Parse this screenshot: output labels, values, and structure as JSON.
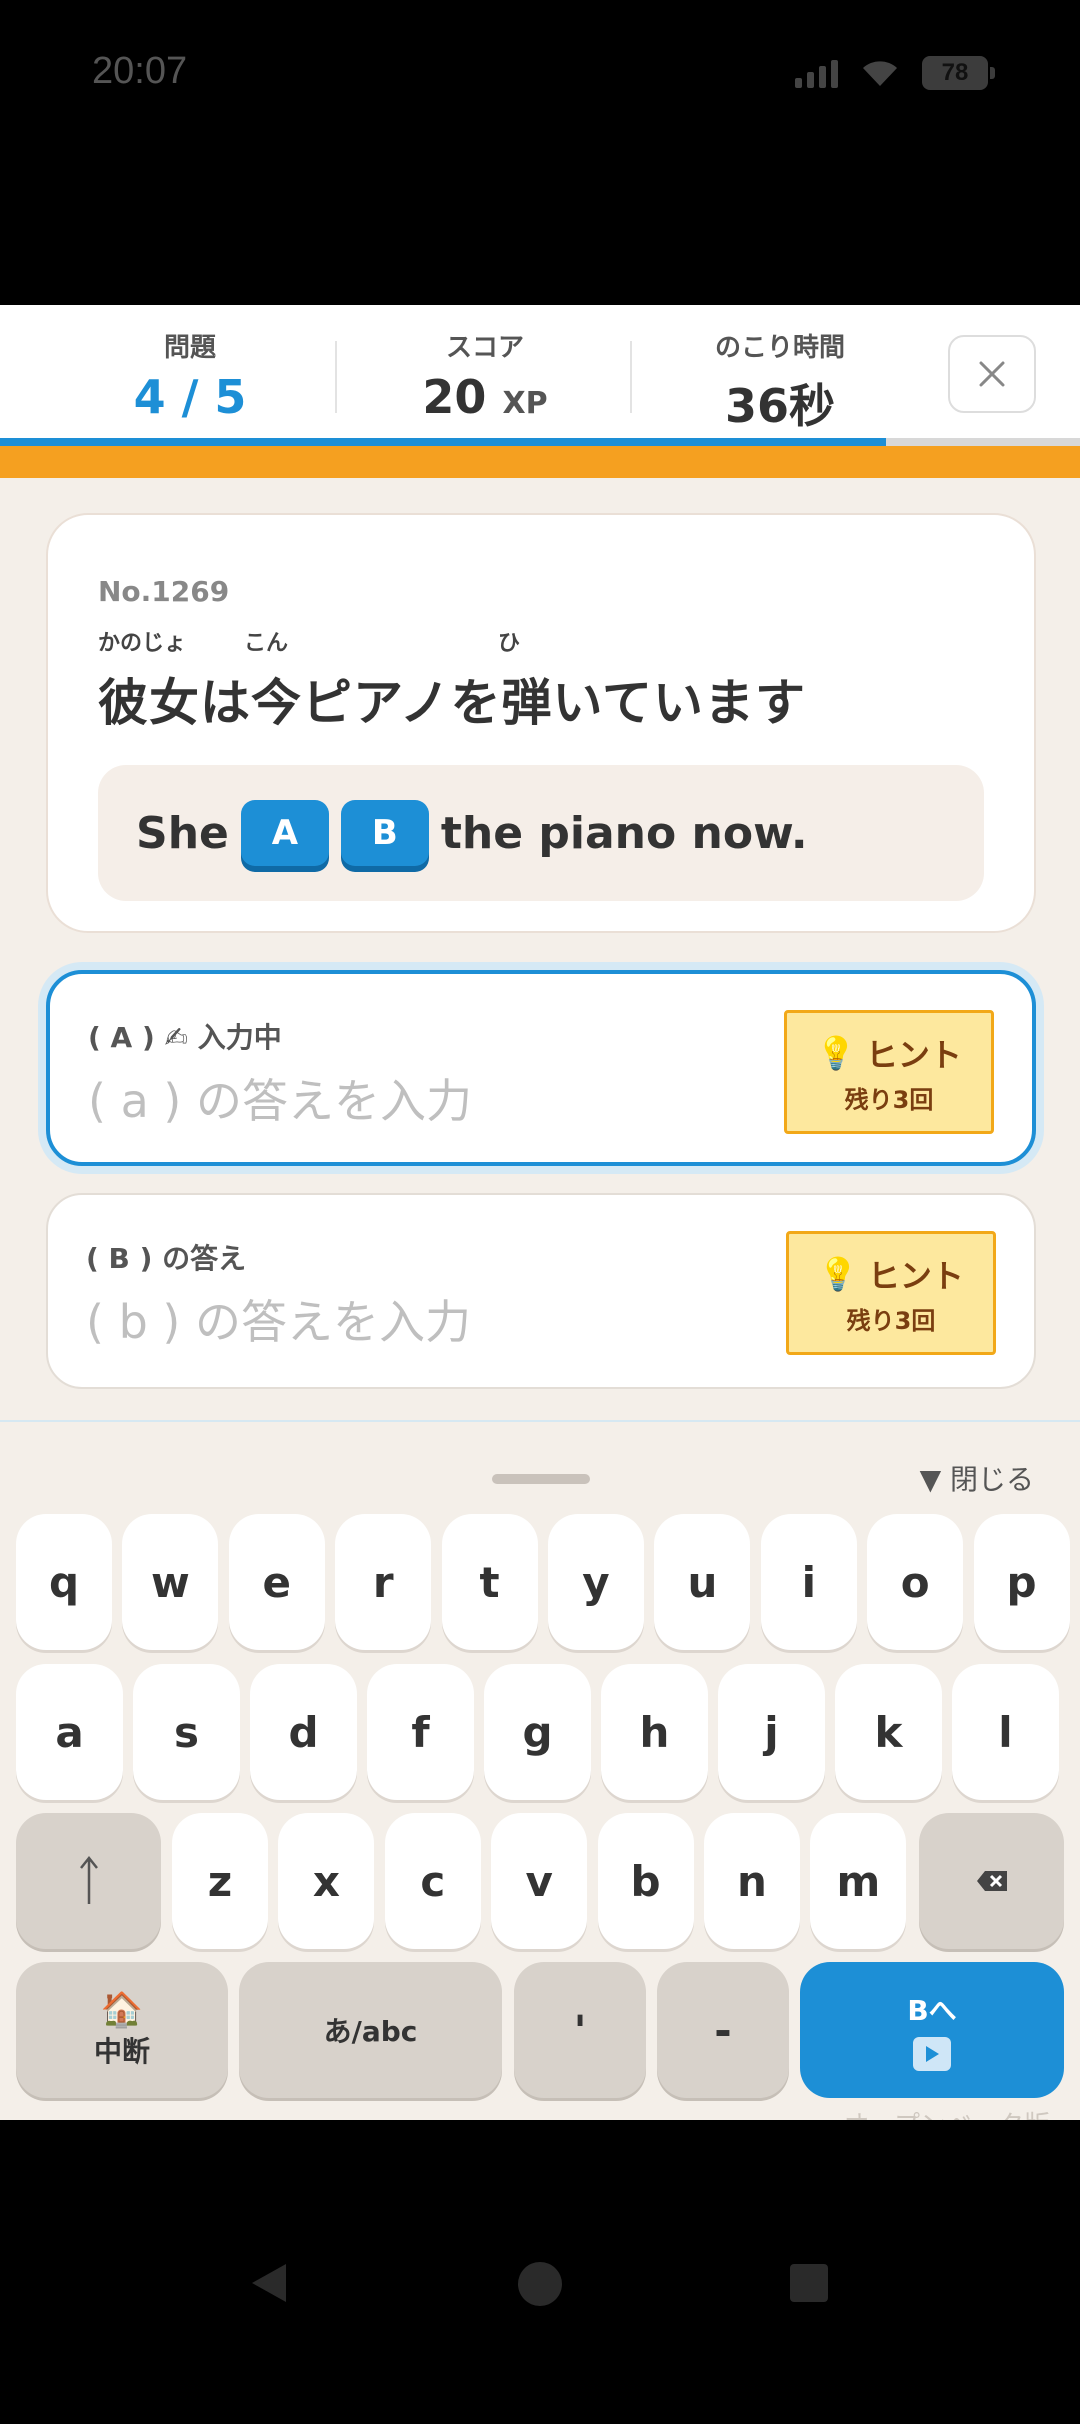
{
  "status_bar": {
    "time": "20:07",
    "battery": "78"
  },
  "header": {
    "question_label": "問題",
    "question_value": "4 / 5",
    "score_label": "スコア",
    "score_value": "20",
    "score_unit": "XP",
    "time_label": "のこり時間",
    "time_value": "36秒",
    "progress_fraction": 0.82
  },
  "question": {
    "number": "No.1269",
    "ruby": [
      "かのじょ",
      "こん",
      "ひ"
    ],
    "japanese": "彼女は今ピアノを弾いています",
    "english_before": "She",
    "blank_a": "A",
    "blank_b": "B",
    "english_after": "the piano now."
  },
  "answers": [
    {
      "label": "( A ) ✍ 入力中",
      "placeholder": "( a ) の答えを入力",
      "hint_label": "ヒント",
      "hint_remaining": "残り3回"
    },
    {
      "label": "( B ) の答え",
      "placeholder": "( b ) の答えを入力",
      "hint_label": "ヒント",
      "hint_remaining": "残り3回"
    }
  ],
  "keyboard": {
    "close_label": "▼ 閉じる",
    "row1": [
      "q",
      "w",
      "e",
      "r",
      "t",
      "y",
      "u",
      "i",
      "o",
      "p"
    ],
    "row2": [
      "a",
      "s",
      "d",
      "f",
      "g",
      "h",
      "j",
      "k",
      "l"
    ],
    "row3": [
      "z",
      "x",
      "c",
      "v",
      "b",
      "n",
      "m"
    ],
    "quit_label": "中断",
    "lang_label": "あ/abc",
    "apostrophe": "'",
    "hyphen": "-",
    "next_label": "Bへ"
  },
  "beta_label": "オープンベータ版",
  "colors": {
    "accent": "#1d8fd6",
    "orange": "#f5a020",
    "hint_bg": "#fde89e"
  }
}
